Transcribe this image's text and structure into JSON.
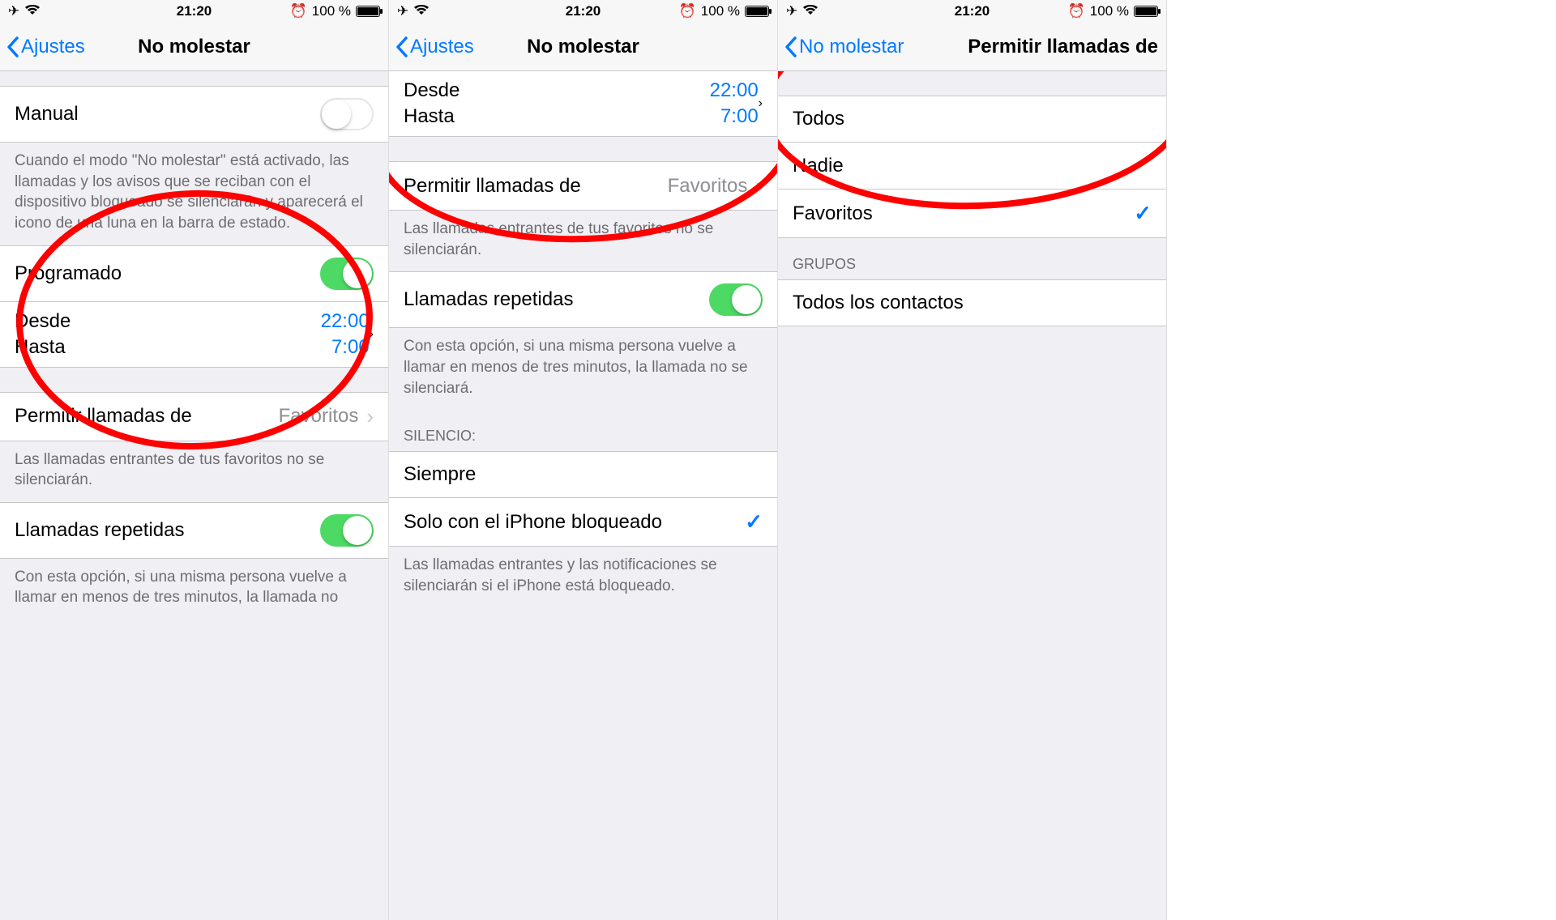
{
  "status": {
    "time": "21:20",
    "battery": "100 %"
  },
  "s1": {
    "back": "Ajustes",
    "title": "No molestar",
    "manual": "Manual",
    "manual_footer": "Cuando el modo \"No molestar\" está activado, las llamadas y los avisos que se reciban con el dispositivo bloqueado se silenciarán y aparecerá el icono de una luna en la barra de estado.",
    "programado": "Programado",
    "desde": "Desde",
    "desde_val": "22:00",
    "hasta": "Hasta",
    "hasta_val": "7:00",
    "permitir": "Permitir llamadas de",
    "permitir_val": "Favoritos",
    "permitir_footer": "Las llamadas entrantes de tus favoritos no se silenciarán.",
    "repetidas": "Llamadas repetidas",
    "repetidas_footer": "Con esta opción, si una misma persona vuelve a llamar en menos de tres minutos, la llamada no"
  },
  "s2": {
    "back": "Ajustes",
    "title": "No molestar",
    "desde": "Desde",
    "desde_val": "22:00",
    "hasta": "Hasta",
    "hasta_val": "7:00",
    "permitir": "Permitir llamadas de",
    "permitir_val": "Favoritos",
    "permitir_footer": "Las llamadas entrantes de tus favoritos no se silenciarán.",
    "repetidas": "Llamadas repetidas",
    "repetidas_footer": "Con esta opción, si una misma persona vuelve a llamar en menos de tres minutos, la llamada no se silenciará.",
    "silencio_header": "SILENCIO:",
    "siempre": "Siempre",
    "solo": "Solo con el iPhone bloqueado",
    "silencio_footer": "Las llamadas entrantes y las notificaciones se silenciarán si el iPhone está bloqueado."
  },
  "s3": {
    "back": "No molestar",
    "title": "Permitir llamadas de",
    "todos": "Todos",
    "nadie": "Nadie",
    "favoritos": "Favoritos",
    "grupos_header": "GRUPOS",
    "contactos": "Todos los contactos"
  }
}
